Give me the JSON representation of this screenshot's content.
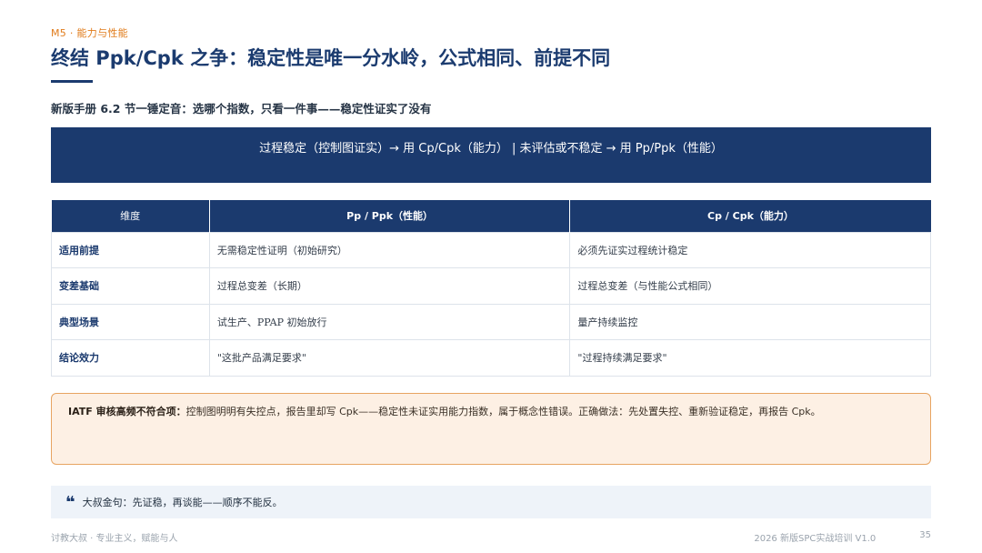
{
  "kicker": "M5 · 能力与性能",
  "title": "终结 Ppk/Cpk 之争：稳定性是唯一分水岭，公式相同、前提不同",
  "subtitle": "新版手册 6.2 节一锤定音：选哪个指数，只看一件事——稳定性证实了没有",
  "banner": "过程稳定（控制图证实）→ 用 Cp/Cpk（能力） | 未评估或不稳定 → 用 Pp/Ppk（性能）",
  "table": {
    "headers": [
      "维度",
      "Pp / Ppk（性能）",
      "Cp / Cpk（能力）"
    ],
    "rows": [
      [
        "适用前提",
        "无需稳定性证明（初始研究）",
        "必须先证实过程统计稳定"
      ],
      [
        "变差基础",
        "过程总变差（长期）",
        "过程总变差（与性能公式相同）"
      ],
      [
        "典型场景",
        "试生产、PPAP 初始放行",
        "量产持续监控"
      ],
      [
        "结论效力",
        "\"这批产品满足要求\"",
        "\"过程持续满足要求\""
      ]
    ]
  },
  "warning": {
    "label": "IATF 审核高频不符合项：",
    "text": "控制图明明有失控点，报告里却写 Cpk——稳定性未证实用能力指数，属于概念性错误。正确做法：先处置失控、重新验证稳定，再报告 Cpk。"
  },
  "quote": {
    "icon": "quote-icon",
    "text": "大叔金句：先证稳，再谈能——顺序不能反。"
  },
  "footer": {
    "left": "讨教大叔 · 专业主义，赋能与人",
    "course": "2026 新版SPC实战培训 V1.0",
    "page": "35"
  },
  "colors": {
    "primary": "#1b3a6e",
    "accent": "#e07b1a",
    "warn_border": "#e7a461",
    "warn_bg": "#fdf0e4"
  }
}
